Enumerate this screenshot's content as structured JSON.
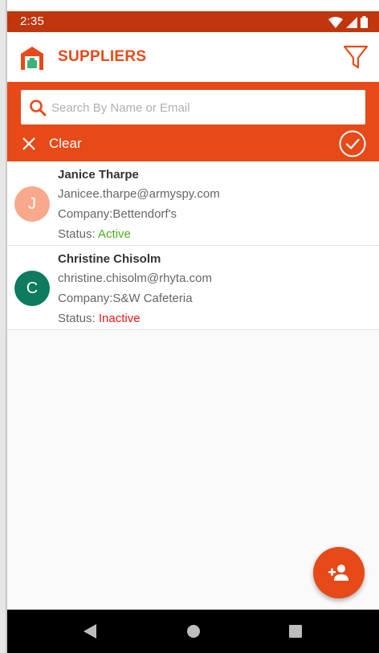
{
  "status_bar": {
    "time": "2:35"
  },
  "app_bar": {
    "title": "SUPPLIERS"
  },
  "search": {
    "placeholder": "Search By Name or Email",
    "clear_label": "Clear"
  },
  "suppliers": [
    {
      "initial": "J",
      "avatar_color": "#f8a98b",
      "name": "Janice Tharpe",
      "email": "Janicee.tharpe@armyspy.com",
      "company": "Company:Bettendorf's",
      "status_label": "Status:",
      "status": "Active",
      "status_color": "#4caf1d"
    },
    {
      "initial": "C",
      "avatar_color": "#0e7a5f",
      "name": "Christine Chisolm",
      "email": "christine.chisolm@rhyta.com",
      "company": "Company:S&W Cafeteria",
      "status_label": "Status:",
      "status": "Inactive",
      "status_color": "#f01818"
    }
  ],
  "colors": {
    "accent": "#e64a19",
    "status_bar": "#c0360f"
  },
  "icons": [
    "warehouse-logo-icon",
    "filter-icon",
    "search-icon",
    "close-icon",
    "check-circle-icon",
    "add-person-icon",
    "nav-back-icon",
    "nav-home-icon",
    "nav-recents-icon",
    "wifi-icon",
    "signal-icon",
    "battery-icon"
  ]
}
